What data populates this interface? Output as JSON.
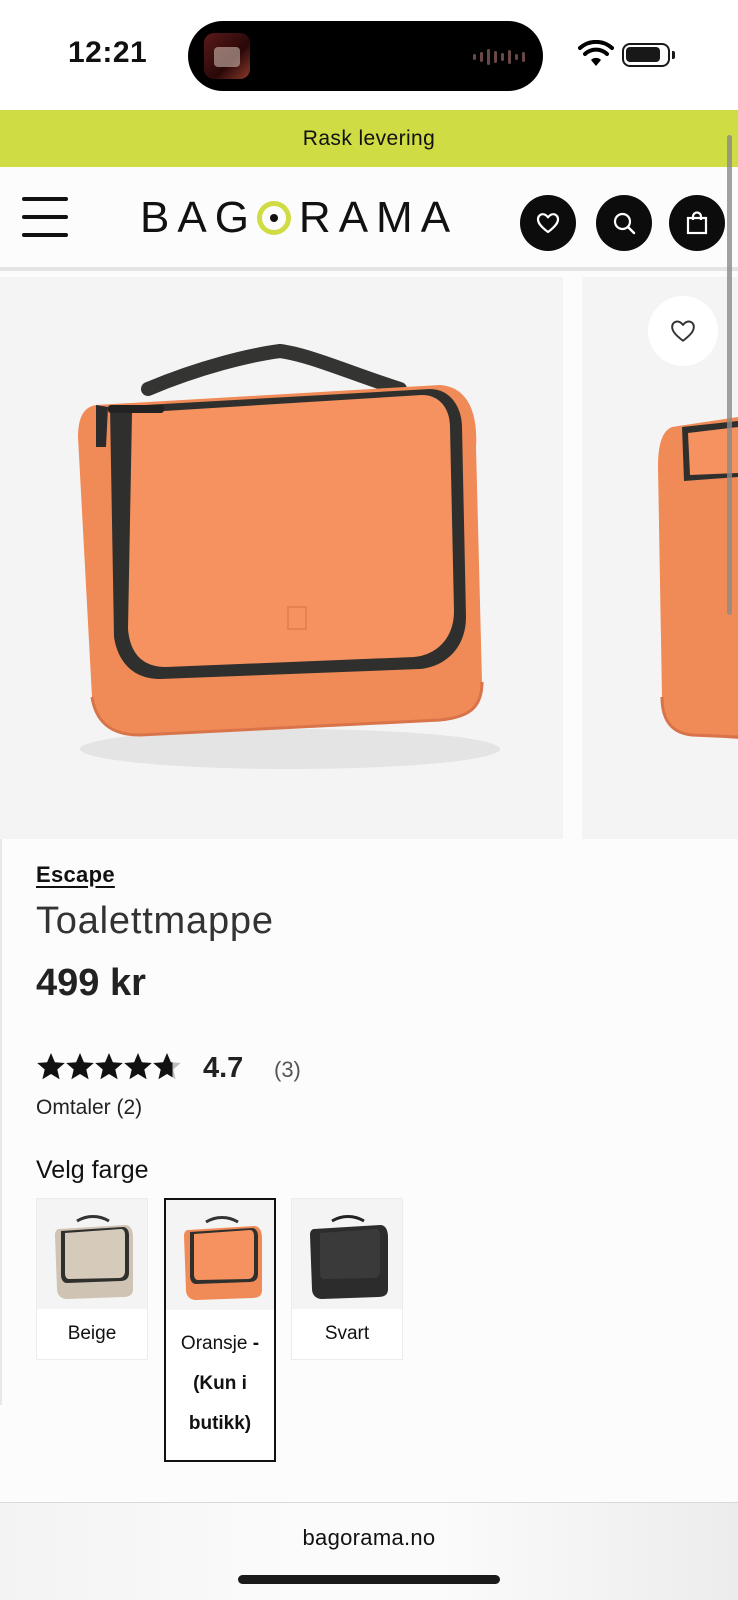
{
  "status_bar": {
    "time": "12:21"
  },
  "promo_banner": {
    "text": "Rask levering"
  },
  "header": {
    "logo_left": "BAG",
    "logo_right": "RAMA",
    "menu_icon": "hamburger-menu-icon",
    "wishlist_icon": "heart-icon",
    "search_icon": "search-icon",
    "cart_icon": "shopping-bag-icon"
  },
  "product": {
    "brand": "Escape",
    "title": "Toalettmappe",
    "price": "499 kr",
    "rating": {
      "stars": 4.7,
      "value_text": "4.7",
      "count_text": "(3)"
    },
    "reviews_link": "Omtaler (2)"
  },
  "color_picker": {
    "heading": "Velg farge",
    "options": [
      {
        "label": "Beige",
        "note": "",
        "selected": false,
        "color": "#cfc3b3"
      },
      {
        "label": "Oransje",
        "note": "- (Kun i butikk)",
        "selected": true,
        "color": "#f28a55"
      },
      {
        "label": "Svart",
        "note": "",
        "selected": false,
        "color": "#2c2c2c"
      }
    ]
  },
  "browser": {
    "url": "bagorama.no"
  },
  "colors": {
    "accent": "#cfdc44",
    "product_orange": "#f28a55",
    "strap_dark": "#2f302e"
  }
}
